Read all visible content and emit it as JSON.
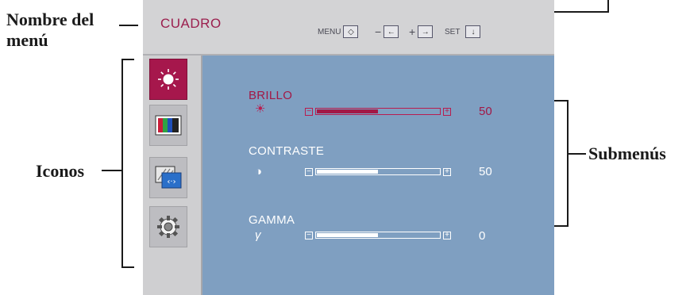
{
  "osd": {
    "menu_title": "CUADRO",
    "hints": [
      {
        "label": "MENU",
        "key": "◇"
      },
      {
        "label": "−",
        "key": "←"
      },
      {
        "label": "+",
        "key": "→"
      },
      {
        "label": "SET",
        "key": "↓"
      }
    ],
    "icons": [
      {
        "name": "brightness-icon",
        "selected": true
      },
      {
        "name": "color-bars-icon",
        "selected": false
      },
      {
        "name": "position-icon",
        "selected": false
      },
      {
        "name": "settings-gear-icon",
        "selected": false
      }
    ],
    "items": [
      {
        "label": "BRILLO",
        "icon": "☀",
        "value": "50",
        "level": 0.5,
        "active": true
      },
      {
        "label": "CONTRASTE",
        "icon": "◑",
        "value": "50",
        "level": 0.5,
        "active": false
      },
      {
        "label": "GAMMA",
        "icon": "γ",
        "value": "0",
        "level": 0.5,
        "active": false
      }
    ],
    "minus": "−",
    "plus": "+"
  },
  "annotations": {
    "menu_name": [
      "Nombre del",
      "menú"
    ],
    "icons": "Iconos",
    "submenus": "Submenús"
  },
  "colors": {
    "accent": "#a21846",
    "panel": "#7f9fc1",
    "frame": "#cfcfd1"
  }
}
